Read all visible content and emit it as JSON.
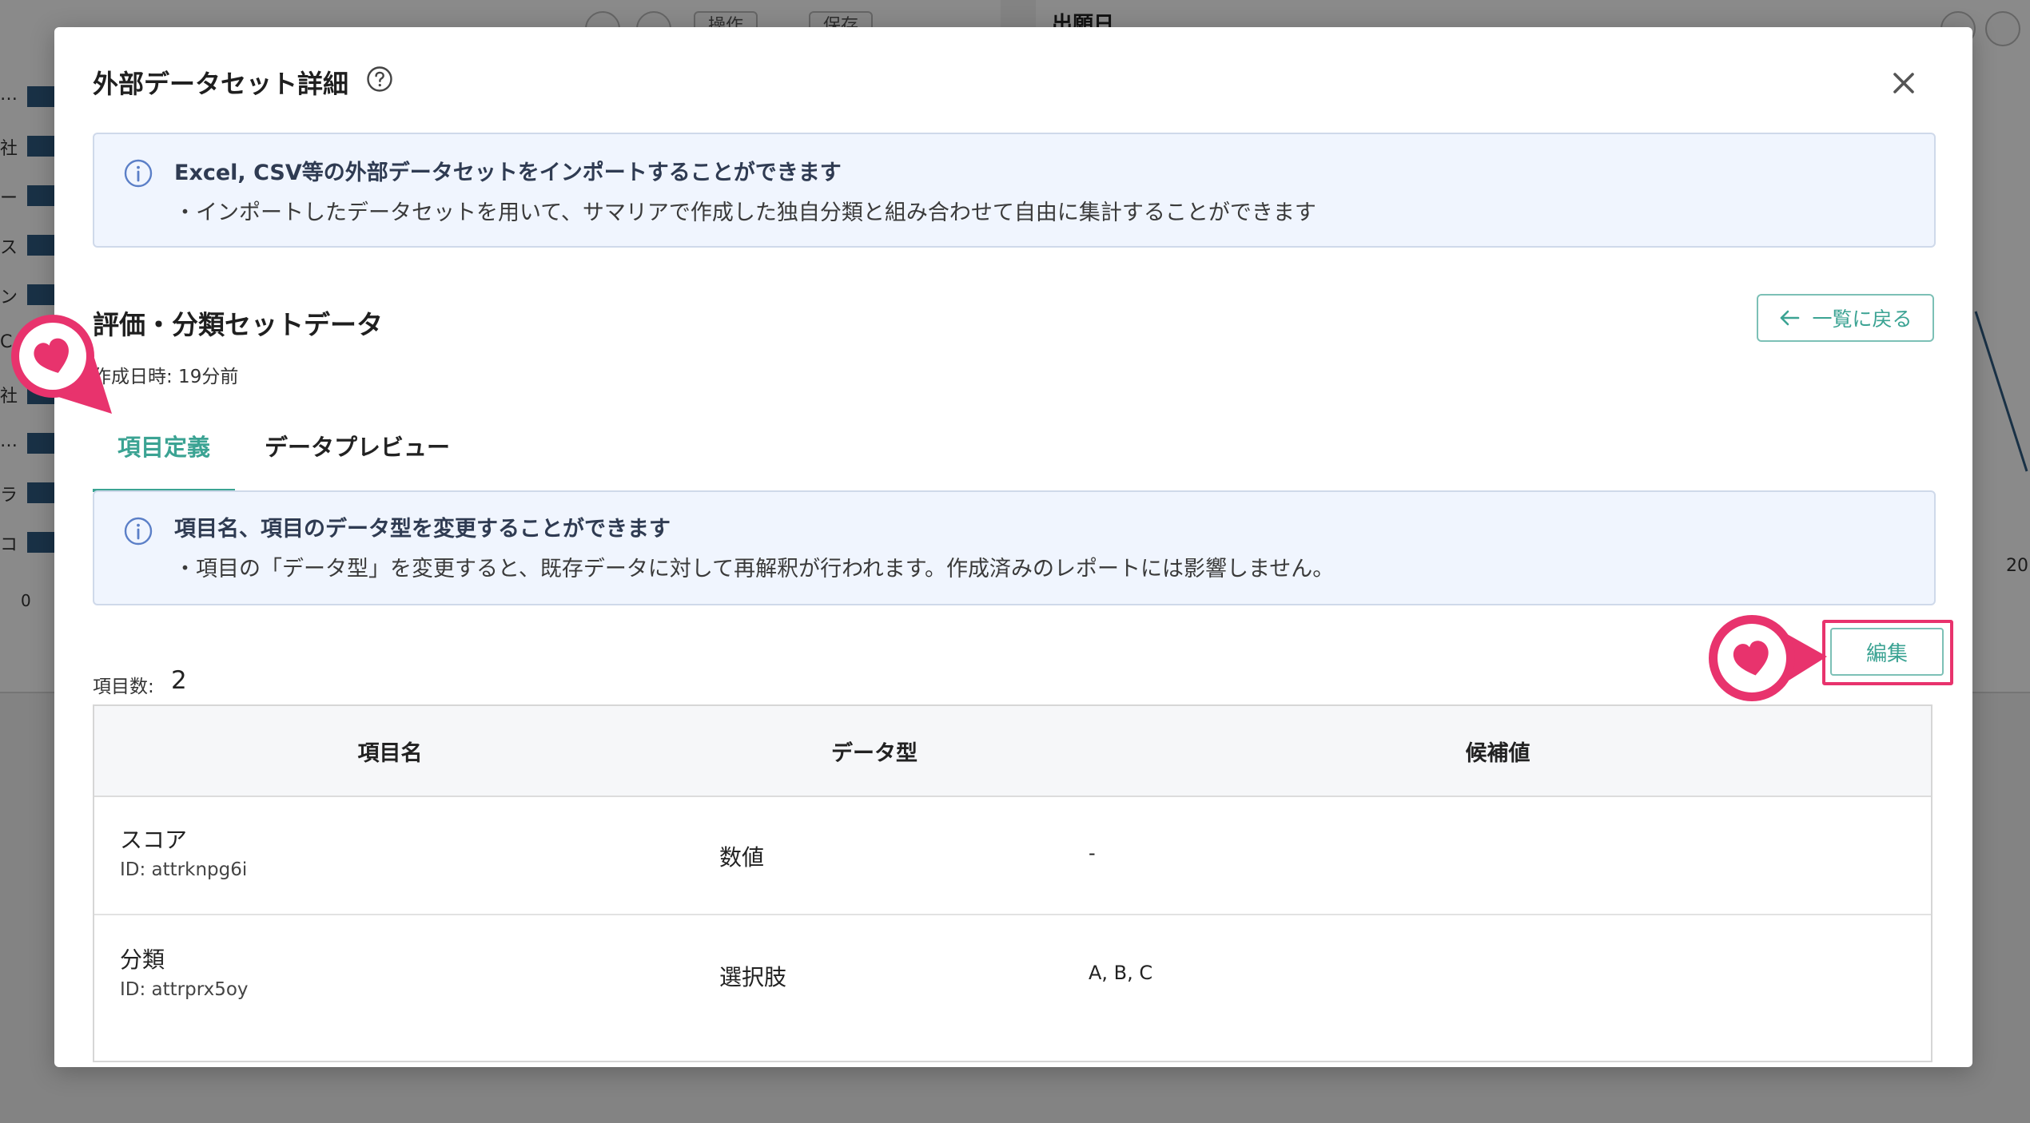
{
  "background": {
    "toolbar": {
      "operations_label": "操作",
      "save_label": "保存"
    },
    "right_panel_title": "出願日",
    "left_labels": [
      "…",
      "社",
      "ー",
      "ス",
      "ン",
      "C",
      "社",
      "…",
      "ラ",
      "コ"
    ],
    "axis_zero": "0",
    "axis_right": "20"
  },
  "modal": {
    "title": "外部データセット詳細",
    "info_banner": {
      "title": "Excel, CSV等の外部データセットをインポートすることができます",
      "text": "・インポートしたデータセットを用いて、サマリアで作成した独自分類と組み合わせて自由に集計することができます"
    },
    "dataset": {
      "name": "評価・分類セットデータ",
      "created_at": "作成日時: 19分前"
    },
    "back_button_label": "一覧に戻る",
    "tabs": [
      {
        "label": "項目定義",
        "active": true
      },
      {
        "label": "データプレビュー",
        "active": false
      }
    ],
    "field_info": {
      "title": "項目名、項目のデータ型を変更することができます",
      "text": "・項目の「データ型」を変更すると、既存データに対して再解釈が行われます。作成済みのレポートには影響しません。"
    },
    "count": {
      "label": "項目数:",
      "value": "2"
    },
    "edit_button_label": "編集",
    "table": {
      "headers": [
        "項目名",
        "データ型",
        "候補値"
      ],
      "rows": [
        {
          "name": "スコア",
          "id": "ID: attrknpg6i",
          "type": "数値",
          "candidates": "-"
        },
        {
          "name": "分類",
          "id": "ID: attrprx5oy",
          "type": "選択肢",
          "candidates": "A, B, C"
        }
      ]
    }
  },
  "colors": {
    "accent": "#3ba393",
    "highlight": "#e8336d",
    "info_bg": "#f0f5fe",
    "chart_bar": "#2f5b82"
  },
  "icons": [
    "help-circle-icon",
    "close-icon",
    "info-icon",
    "arrow-left-icon",
    "heart-marker-icon"
  ]
}
